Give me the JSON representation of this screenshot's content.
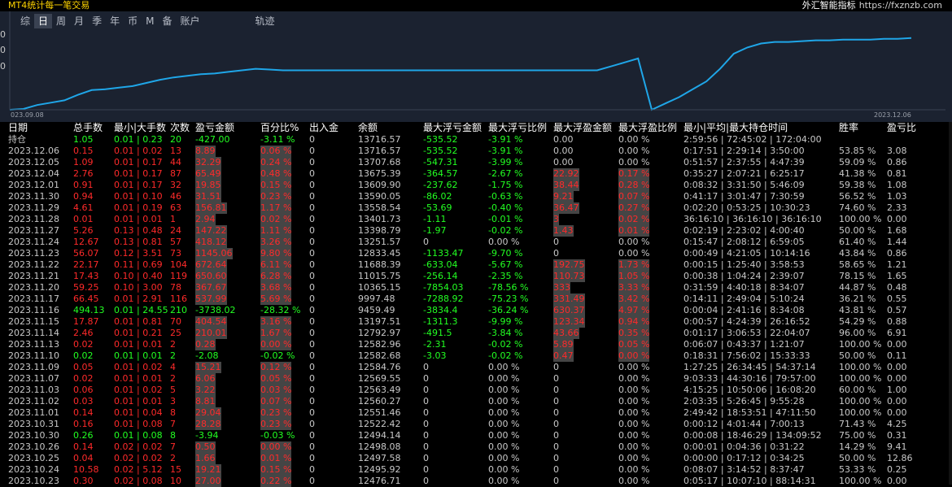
{
  "title": "MT4统计每一笔交易",
  "brand": {
    "name": "外汇智能指标",
    "url": "https://fxznzb.com"
  },
  "tabs": [
    {
      "label": "综",
      "active": false
    },
    {
      "label": "日",
      "active": true
    },
    {
      "label": "周",
      "active": false
    },
    {
      "label": "月",
      "active": false
    },
    {
      "label": "季",
      "active": false
    },
    {
      "label": "年",
      "active": false
    },
    {
      "label": "币",
      "active": false
    },
    {
      "label": "M",
      "active": false
    },
    {
      "label": "备",
      "active": false
    },
    {
      "label": "账户",
      "active": false
    },
    {
      "label": "轨迹",
      "active": false
    }
  ],
  "chart_data": {
    "type": "line",
    "x_start_label": "023.09.08",
    "x_end_label": "2023.12.06",
    "y_tick_labels": [
      "0",
      "0",
      "0"
    ],
    "line_color": "#1fa6e8",
    "values": [
      0.0,
      0.01,
      0.06,
      0.09,
      0.12,
      0.19,
      0.25,
      0.26,
      0.28,
      0.3,
      0.34,
      0.38,
      0.41,
      0.43,
      0.45,
      0.46,
      0.48,
      0.5,
      0.52,
      0.51,
      0.5,
      0.5,
      0.5,
      0.5,
      0.5,
      0.5,
      0.5,
      0.5,
      0.5,
      0.5,
      0.5,
      0.5,
      0.5,
      0.5,
      0.5,
      0.5,
      0.5,
      0.5,
      0.5,
      0.5,
      0.5,
      0.5,
      0.5,
      0.5,
      0.55,
      0.6,
      0.65,
      0.0,
      0.08,
      0.16,
      0.26,
      0.36,
      0.52,
      0.71,
      0.79,
      0.84,
      0.86,
      0.86,
      0.87,
      0.88,
      0.88,
      0.89,
      0.89,
      0.89,
      0.9,
      0.9,
      0.91
    ]
  },
  "headers": [
    "日期",
    "总手数",
    "最小|大手数",
    "次数",
    "盈亏金额",
    "百分比%",
    "出入金",
    "余额",
    "最大浮亏金额",
    "最大浮亏比例",
    "最大浮盈金额",
    "最大浮盈比例",
    "最小|平均|最大持仓时间",
    "胜率",
    "盈亏比"
  ],
  "holding": {
    "label": "持仓",
    "lots": "1.05",
    "minmax": "0.01 | 0.23",
    "count": "20",
    "pnl": "-427.00",
    "pct": "-3.11 %",
    "dep": "0",
    "bal": "13716.57",
    "mfl": "-535.52",
    "mflp": "-3.91 %",
    "mfp": "0.00",
    "mfpp": "0.00 %",
    "time": "2:59:56 | 72:45:02 | 172:04:00",
    "win": "",
    "ratio": ""
  },
  "rows": [
    {
      "date": "2023.12.06",
      "lots": "0.15",
      "minmax": "0.01 | 0.02",
      "count": "13",
      "pnl": "8.89",
      "pct": "0.06 %",
      "dep": "0",
      "bal": "13716.57",
      "mfl": "-535.52",
      "mflp": "-3.91 %",
      "mfp": "0.00",
      "mfpp": "0.00 %",
      "time": "0:17:51 | 2:29:14 | 3:50:00",
      "win": "53.85 %",
      "ratio": "3.08"
    },
    {
      "date": "2023.12.05",
      "lots": "1.09",
      "minmax": "0.01 | 0.17",
      "count": "44",
      "pnl": "32.29",
      "pct": "0.24 %",
      "dep": "0",
      "bal": "13707.68",
      "mfl": "-547.31",
      "mflp": "-3.99 %",
      "mfp": "0.00",
      "mfpp": "0.00 %",
      "time": "0:51:57 | 2:37:55 | 4:47:39",
      "win": "59.09 %",
      "ratio": "0.86"
    },
    {
      "date": "2023.12.04",
      "lots": "2.76",
      "minmax": "0.01 | 0.17",
      "count": "87",
      "pnl": "65.49",
      "pct": "0.48 %",
      "dep": "0",
      "bal": "13675.39",
      "mfl": "-364.57",
      "mflp": "-2.67 %",
      "mfp": "22.92",
      "mfpp": "0.17 %",
      "time": "0:35:27 | 2:07:21 | 6:25:17",
      "win": "41.38 %",
      "ratio": "0.81"
    },
    {
      "date": "2023.12.01",
      "lots": "0.91",
      "minmax": "0.01 | 0.17",
      "count": "32",
      "pnl": "19.85",
      "pct": "0.15 %",
      "dep": "0",
      "bal": "13609.90",
      "mfl": "-237.62",
      "mflp": "-1.75 %",
      "mfp": "38.44",
      "mfpp": "0.28 %",
      "time": "0:08:32 | 3:31:50 | 5:46:09",
      "win": "59.38 %",
      "ratio": "1.08"
    },
    {
      "date": "2023.11.30",
      "lots": "0.94",
      "minmax": "0.01 | 0.10",
      "count": "46",
      "pnl": "31.51",
      "pct": "0.23 %",
      "dep": "0",
      "bal": "13590.05",
      "mfl": "-86.02",
      "mflp": "-0.63 %",
      "mfp": "9.21",
      "mfpp": "0.07 %",
      "time": "0:41:17 | 3:01:47 | 7:30:59",
      "win": "56.52 %",
      "ratio": "1.03"
    },
    {
      "date": "2023.11.29",
      "lots": "4.61",
      "minmax": "0.01 | 0.19",
      "count": "63",
      "pnl": "156.81",
      "pct": "1.17 %",
      "dep": "0",
      "bal": "13558.54",
      "mfl": "-53.69",
      "mflp": "-0.40 %",
      "mfp": "36.47",
      "mfpp": "0.27 %",
      "time": "0:02:20 | 0:53:25 | 10:30:23",
      "win": "74.60 %",
      "ratio": "2.33"
    },
    {
      "date": "2023.11.28",
      "lots": "0.01",
      "minmax": "0.01 | 0.01",
      "count": "1",
      "pnl": "2.94",
      "pct": "0.02 %",
      "dep": "0",
      "bal": "13401.73",
      "mfl": "-1.11",
      "mflp": "-0.01 %",
      "mfp": "3",
      "mfpp": "0.02 %",
      "time": "36:16:10 | 36:16:10 | 36:16:10",
      "win": "100.00 %",
      "ratio": "0.00"
    },
    {
      "date": "2023.11.27",
      "lots": "5.26",
      "minmax": "0.13 | 0.48",
      "count": "24",
      "pnl": "147.22",
      "pct": "1.11 %",
      "dep": "0",
      "bal": "13398.79",
      "mfl": "-1.97",
      "mflp": "-0.02 %",
      "mfp": "1.43",
      "mfpp": "0.01 %",
      "time": "0:02:19 | 2:23:02 | 4:00:40",
      "win": "50.00 %",
      "ratio": "1.68"
    },
    {
      "date": "2023.11.24",
      "lots": "12.67",
      "minmax": "0.13 | 0.81",
      "count": "57",
      "pnl": "418.12",
      "pct": "3.26 %",
      "dep": "0",
      "bal": "13251.57",
      "mfl": "0",
      "mflp": "0.00 %",
      "mfp": "0",
      "mfpp": "0.00 %",
      "time": "0:15:47 | 2:08:12 | 6:59:05",
      "win": "61.40 %",
      "ratio": "1.44"
    },
    {
      "date": "2023.11.23",
      "lots": "56.07",
      "minmax": "0.12 | 3.51",
      "count": "73",
      "pnl": "1145.06",
      "pct": "9.80 %",
      "dep": "0",
      "bal": "12833.45",
      "mfl": "-1133.47",
      "mflp": "-9.70 %",
      "mfp": "0",
      "mfpp": "0.00 %",
      "time": "0:00:49 | 4:21:05 | 10:14:16",
      "win": "43.84 %",
      "ratio": "0.86"
    },
    {
      "date": "2023.11.22",
      "lots": "22.17",
      "minmax": "0.11 | 0.69",
      "count": "104",
      "pnl": "672.64",
      "pct": "6.11 %",
      "dep": "0",
      "bal": "11688.39",
      "mfl": "-633.04",
      "mflp": "-5.67 %",
      "mfp": "192.75",
      "mfpp": "1.73 %",
      "time": "0:00:15 | 1:25:40 | 3:58:53",
      "win": "58.65 %",
      "ratio": "1.21"
    },
    {
      "date": "2023.11.21",
      "lots": "17.43",
      "minmax": "0.10 | 0.40",
      "count": "119",
      "pnl": "650.60",
      "pct": "6.28 %",
      "dep": "0",
      "bal": "11015.75",
      "mfl": "-256.14",
      "mflp": "-2.35 %",
      "mfp": "110.73",
      "mfpp": "1.05 %",
      "time": "0:00:38 | 1:04:24 | 2:39:07",
      "win": "78.15 %",
      "ratio": "1.65"
    },
    {
      "date": "2023.11.20",
      "lots": "59.25",
      "minmax": "0.10 | 3.00",
      "count": "78",
      "pnl": "367.67",
      "pct": "3.68 %",
      "dep": "0",
      "bal": "10365.15",
      "mfl": "-7854.03",
      "mflp": "-78.56 %",
      "mfp": "333",
      "mfpp": "3.33 %",
      "time": "0:31:59 | 4:40:18 | 8:34:07",
      "win": "44.87 %",
      "ratio": "0.48"
    },
    {
      "date": "2023.11.17",
      "lots": "66.45",
      "minmax": "0.01 | 2.91",
      "count": "116",
      "pnl": "537.99",
      "pct": "5.69 %",
      "dep": "0",
      "bal": "9997.48",
      "mfl": "-7288.92",
      "mflp": "-75.23 %",
      "mfp": "331.49",
      "mfpp": "3.42 %",
      "time": "0:14:11 | 2:49:04 | 5:10:24",
      "win": "36.21 %",
      "ratio": "0.55"
    },
    {
      "date": "2023.11.16",
      "lots": "494.13",
      "minmax": "0.01 | 24.55",
      "count": "210",
      "pnl": "-3738.02",
      "pct": "-28.32 %",
      "dep": "0",
      "bal": "9459.49",
      "mfl": "-3834.4",
      "mflp": "-36.24 %",
      "mfp": "630.37",
      "mfpp": "4.97 %",
      "time": "0:00:04 | 2:41:16 | 8:34:08",
      "win": "43.81 %",
      "ratio": "0.57"
    },
    {
      "date": "2023.11.15",
      "lots": "17.87",
      "minmax": "0.01 | 0.81",
      "count": "70",
      "pnl": "404.54",
      "pct": "3.16 %",
      "dep": "0",
      "bal": "13197.51",
      "mfl": "-1311.3",
      "mflp": "-9.99 %",
      "mfp": "123.34",
      "mfpp": "0.94 %",
      "time": "0:00:57 | 4:24:39 | 26:16:52",
      "win": "54.29 %",
      "ratio": "0.88"
    },
    {
      "date": "2023.11.14",
      "lots": "2.46",
      "minmax": "0.01 | 0.21",
      "count": "25",
      "pnl": "210.01",
      "pct": "1.67 %",
      "dep": "0",
      "bal": "12792.97",
      "mfl": "-491.5",
      "mflp": "-3.84 %",
      "mfp": "43.66",
      "mfpp": "0.35 %",
      "time": "0:01:17 | 3:06:53 | 22:04:07",
      "win": "96.00 %",
      "ratio": "6.91"
    },
    {
      "date": "2023.11.13",
      "lots": "0.02",
      "minmax": "0.01 | 0.01",
      "count": "2",
      "pnl": "0.28",
      "pct": "0.00 %",
      "dep": "0",
      "bal": "12582.96",
      "mfl": "-2.31",
      "mflp": "-0.02 %",
      "mfp": "5.89",
      "mfpp": "0.05 %",
      "time": "0:06:07 | 0:43:37 | 1:21:07",
      "win": "100.00 %",
      "ratio": "0.00"
    },
    {
      "date": "2023.11.10",
      "lots": "0.02",
      "minmax": "0.01 | 0.01",
      "count": "2",
      "pnl": "-2.08",
      "pct": "-0.02 %",
      "dep": "0",
      "bal": "12582.68",
      "mfl": "-3.03",
      "mflp": "-0.02 %",
      "mfp": "0.47",
      "mfpp": "0.00 %",
      "time": "0:18:31 | 7:56:02 | 15:33:33",
      "win": "50.00 %",
      "ratio": "0.11"
    },
    {
      "date": "2023.11.09",
      "lots": "0.05",
      "minmax": "0.01 | 0.02",
      "count": "4",
      "pnl": "15.21",
      "pct": "0.12 %",
      "dep": "0",
      "bal": "12584.76",
      "mfl": "0",
      "mflp": "0.00 %",
      "mfp": "0",
      "mfpp": "0.00 %",
      "time": "1:27:25 | 26:34:45 | 54:37:14",
      "win": "100.00 %",
      "ratio": "0.00"
    },
    {
      "date": "2023.11.07",
      "lots": "0.02",
      "minmax": "0.01 | 0.01",
      "count": "2",
      "pnl": "6.06",
      "pct": "0.05 %",
      "dep": "0",
      "bal": "12569.55",
      "mfl": "0",
      "mflp": "0.00 %",
      "mfp": "0",
      "mfpp": "0.00 %",
      "time": "9:03:33 | 44:30:16 | 79:57:00",
      "win": "100.00 %",
      "ratio": "0.00"
    },
    {
      "date": "2023.11.03",
      "lots": "0.06",
      "minmax": "0.01 | 0.02",
      "count": "5",
      "pnl": "3.22",
      "pct": "0.03 %",
      "dep": "0",
      "bal": "12563.49",
      "mfl": "0",
      "mflp": "0.00 %",
      "mfp": "0",
      "mfpp": "0.00 %",
      "time": "4:15:25 | 10:50:06 | 16:08:20",
      "win": "60.00 %",
      "ratio": "1.00"
    },
    {
      "date": "2023.11.02",
      "lots": "0.03",
      "minmax": "0.01 | 0.01",
      "count": "3",
      "pnl": "8.81",
      "pct": "0.07 %",
      "dep": "0",
      "bal": "12560.27",
      "mfl": "0",
      "mflp": "0.00 %",
      "mfp": "0",
      "mfpp": "0.00 %",
      "time": "2:03:35 | 5:26:45 | 9:55:28",
      "win": "100.00 %",
      "ratio": "0.00"
    },
    {
      "date": "2023.11.01",
      "lots": "0.14",
      "minmax": "0.01 | 0.04",
      "count": "8",
      "pnl": "29.04",
      "pct": "0.23 %",
      "dep": "0",
      "bal": "12551.46",
      "mfl": "0",
      "mflp": "0.00 %",
      "mfp": "0",
      "mfpp": "0.00 %",
      "time": "2:49:42 | 18:53:51 | 47:11:50",
      "win": "100.00 %",
      "ratio": "0.00"
    },
    {
      "date": "2023.10.31",
      "lots": "0.16",
      "minmax": "0.01 | 0.08",
      "count": "7",
      "pnl": "28.28",
      "pct": "0.23 %",
      "dep": "0",
      "bal": "12522.42",
      "mfl": "0",
      "mflp": "0.00 %",
      "mfp": "0",
      "mfpp": "0.00 %",
      "time": "0:00:12 | 4:01:44 | 7:00:13",
      "win": "71.43 %",
      "ratio": "4.25"
    },
    {
      "date": "2023.10.30",
      "lots": "0.26",
      "minmax": "0.01 | 0.08",
      "count": "8",
      "pnl": "-3.94",
      "pct": "-0.03 %",
      "dep": "0",
      "bal": "12494.14",
      "mfl": "0",
      "mflp": "0.00 %",
      "mfp": "0",
      "mfpp": "0.00 %",
      "time": "0:00:08 | 18:46:29 | 134:09:52",
      "win": "75.00 %",
      "ratio": "0.31"
    },
    {
      "date": "2023.10.26",
      "lots": "0.14",
      "minmax": "0.02 | 0.02",
      "count": "7",
      "pnl": "0.50",
      "pct": "0.00 %",
      "dep": "0",
      "bal": "12498.08",
      "mfl": "0",
      "mflp": "0.00 %",
      "mfp": "0",
      "mfpp": "0.00 %",
      "time": "0:00:01 | 0:04:36 | 0:31:22",
      "win": "14.29 %",
      "ratio": "9.41"
    },
    {
      "date": "2023.10.25",
      "lots": "0.04",
      "minmax": "0.02 | 0.02",
      "count": "2",
      "pnl": "1.66",
      "pct": "0.01 %",
      "dep": "0",
      "bal": "12497.58",
      "mfl": "0",
      "mflp": "0.00 %",
      "mfp": "0",
      "mfpp": "0.00 %",
      "time": "0:00:00 | 0:17:12 | 0:34:25",
      "win": "50.00 %",
      "ratio": "12.86"
    },
    {
      "date": "2023.10.24",
      "lots": "10.58",
      "minmax": "0.02 | 5.12",
      "count": "15",
      "pnl": "19.21",
      "pct": "0.15 %",
      "dep": "0",
      "bal": "12495.92",
      "mfl": "0",
      "mflp": "0.00 %",
      "mfp": "0",
      "mfpp": "0.00 %",
      "time": "0:08:07 | 3:14:52 | 8:37:47",
      "win": "53.33 %",
      "ratio": "0.25"
    },
    {
      "date": "2023.10.23",
      "lots": "0.30",
      "minmax": "0.02 | 0.08",
      "count": "10",
      "pnl": "27.00",
      "pct": "0.22 %",
      "dep": "0",
      "bal": "12476.71",
      "mfl": "0",
      "mflp": "0.00 %",
      "mfp": "0",
      "mfpp": "0.00 %",
      "time": "0:05:17 | 10:07:10 | 88:14:31",
      "win": "100.00 %",
      "ratio": "0.00"
    }
  ]
}
